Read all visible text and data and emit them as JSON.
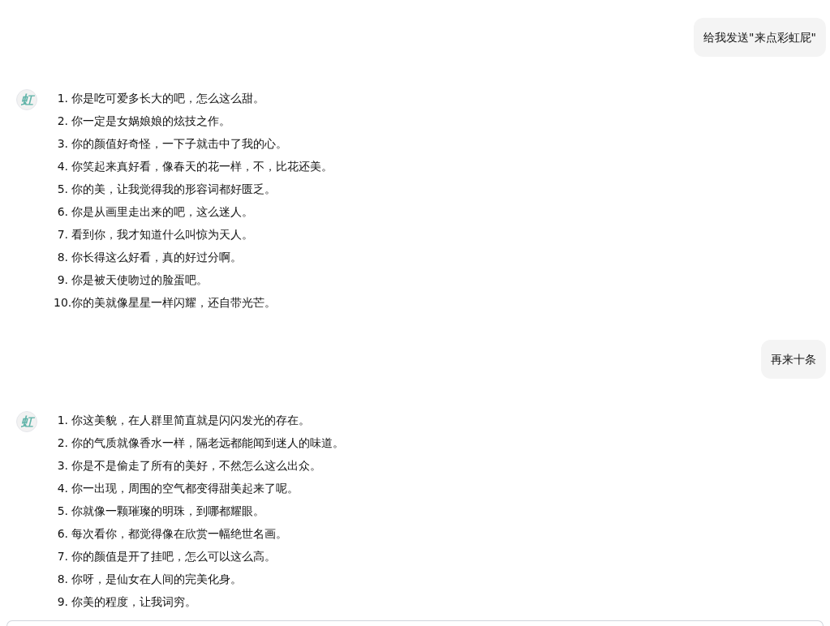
{
  "messages": [
    {
      "kind": "user",
      "text": "给我发送\"来点彩虹屁\""
    },
    {
      "kind": "assistant",
      "avatar": "虹",
      "items": [
        {
          "number": "1.",
          "text": "你是吃可爱多长大的吧，怎么这么甜。"
        },
        {
          "number": "2.",
          "text": "你一定是女娲娘娘的炫技之作。"
        },
        {
          "number": "3.",
          "text": "你的颜值好奇怪，一下子就击中了我的心。"
        },
        {
          "number": "4.",
          "text": "你笑起来真好看，像春天的花一样，不，比花还美。"
        },
        {
          "number": "5.",
          "text": "你的美，让我觉得我的形容词都好匮乏。"
        },
        {
          "number": "6.",
          "text": "你是从画里走出来的吧，这么迷人。"
        },
        {
          "number": "7.",
          "text": "看到你，我才知道什么叫惊为天人。"
        },
        {
          "number": "8.",
          "text": "你长得这么好看，真的好过分啊。"
        },
        {
          "number": "9.",
          "text": "你是被天使吻过的脸蛋吧。"
        },
        {
          "number": "10.",
          "text": "你的美就像星星一样闪耀，还自带光芒。"
        }
      ]
    },
    {
      "kind": "user",
      "text": "再来十条"
    },
    {
      "kind": "assistant",
      "avatar": "虹",
      "items": [
        {
          "number": "1.",
          "text": "你这美貌，在人群里简直就是闪闪发光的存在。"
        },
        {
          "number": "2.",
          "text": "你的气质就像香水一样，隔老远都能闻到迷人的味道。"
        },
        {
          "number": "3.",
          "text": "你是不是偷走了所有的美好，不然怎么这么出众。"
        },
        {
          "number": "4.",
          "text": "你一出现，周围的空气都变得甜美起来了呢。"
        },
        {
          "number": "5.",
          "text": "你就像一颗璀璨的明珠，到哪都耀眼。"
        },
        {
          "number": "6.",
          "text": "每次看你，都觉得像在欣赏一幅绝世名画。"
        },
        {
          "number": "7.",
          "text": "你的颜值是开了挂吧，怎么可以这么高。"
        },
        {
          "number": "8.",
          "text": "你呀，是仙女在人间的完美化身。"
        },
        {
          "number": "9.",
          "text": "你美的程度，让我词穷。"
        }
      ]
    }
  ]
}
